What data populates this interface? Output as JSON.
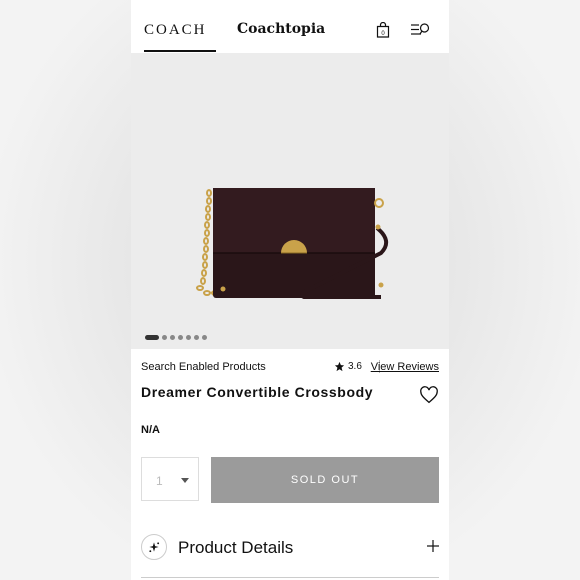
{
  "header": {
    "brand": "COACH",
    "sub_brand": "Coachtopia",
    "bag_count": "0"
  },
  "carousel": {
    "dot_count": 7,
    "active_index": 0
  },
  "product": {
    "tag": "Search Enabled Products",
    "rating": "3.6",
    "reviews_link": "View Reviews",
    "name": "Dreamer Convertible Crossbody",
    "price": "N/A",
    "quantity": "1",
    "sold_out_label": "SOLD OUT",
    "image_subject": "dark leather crossbody bag with gold chain strap"
  },
  "details": {
    "label": "Product Details"
  },
  "colors": {
    "sold_out_bg": "#9b9b9b",
    "bag_leather": "#2a1619",
    "hardware_gold": "#c9a24a"
  }
}
